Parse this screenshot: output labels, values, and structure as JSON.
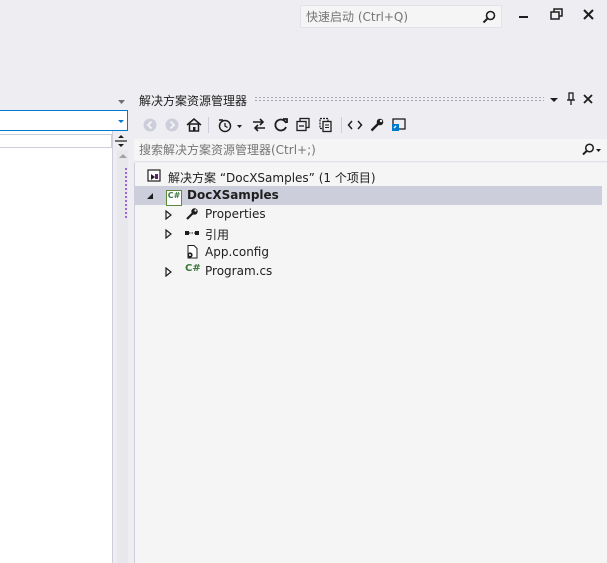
{
  "quick_launch": {
    "placeholder": "快速启动 (Ctrl+Q)"
  },
  "window_buttons": [
    "minimize-icon",
    "restore-icon",
    "close-icon"
  ],
  "solution_explorer": {
    "title": "解决方案资源管理器",
    "search_placeholder": "搜索解决方案资源管理器(Ctrl+;)",
    "toolbar_icons": [
      "back-icon",
      "forward-icon",
      "home-icon",
      "history-icon",
      "sync-icon",
      "refresh-icon",
      "collapse-all-icon",
      "show-all-files-icon",
      "view-code-icon",
      "properties-icon",
      "preview-icon"
    ],
    "tree": {
      "solution": "解决方案 “DocXSamples” (1 个项目)",
      "project": "DocXSamples",
      "items": [
        {
          "label": "Properties",
          "icon": "wrench-icon",
          "expandable": true
        },
        {
          "label": "引用",
          "icon": "references-icon",
          "expandable": true
        },
        {
          "label": "App.config",
          "icon": "config-file-icon",
          "expandable": false
        },
        {
          "label": "Program.cs",
          "icon": "csharp-file-icon",
          "expandable": true
        }
      ]
    }
  },
  "colors": {
    "accent": "#007ACC",
    "selection": "#CCCEDB",
    "background": "#EEEEF2"
  }
}
